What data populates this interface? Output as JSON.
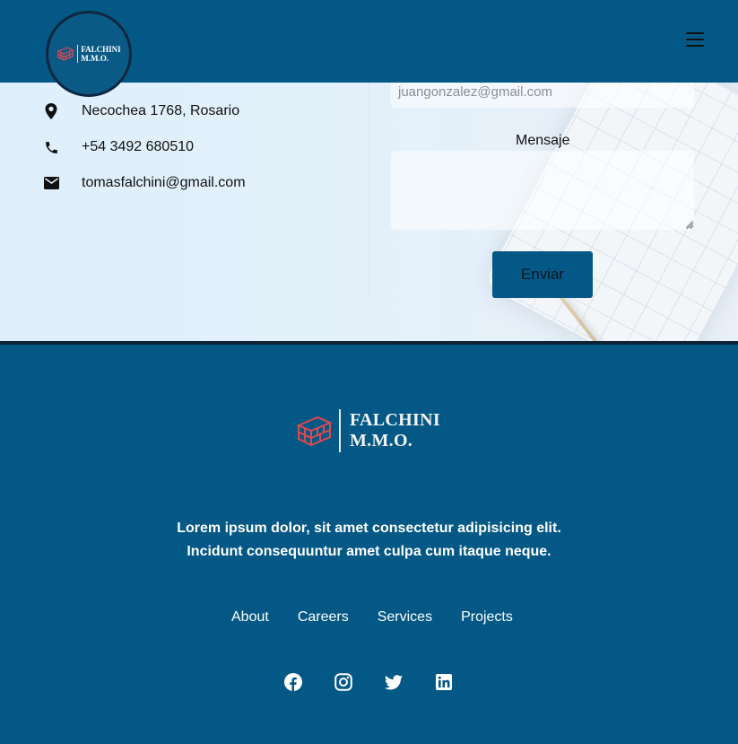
{
  "brand": {
    "line1": "FALCHINI",
    "line2": "M.M.O.",
    "colors": {
      "primary": "#045885",
      "brick": "#e0484f",
      "dark": "#0f2336"
    }
  },
  "header": {
    "menu_icon": "hamburger-icon"
  },
  "contact": {
    "address": "Necochea 1768, Rosario",
    "phone": "+54 3492 680510",
    "email": "tomasfalchini@gmail.com",
    "icons": [
      "location-pin-icon",
      "phone-icon",
      "mail-icon"
    ]
  },
  "form": {
    "email_value": "juangonzalez@gmail.com",
    "message_label": "Mensaje",
    "message_value": "",
    "submit_label": "Enviar"
  },
  "footer": {
    "tagline_line1": "Lorem ipsum dolor, sit amet consectetur adipisicing elit.",
    "tagline_line2": "Incidunt consequuntur amet culpa cum itaque neque.",
    "nav": [
      "About",
      "Careers",
      "Services",
      "Projects"
    ],
    "social": [
      "facebook-icon",
      "instagram-icon",
      "twitter-icon",
      "linkedin-icon"
    ]
  }
}
